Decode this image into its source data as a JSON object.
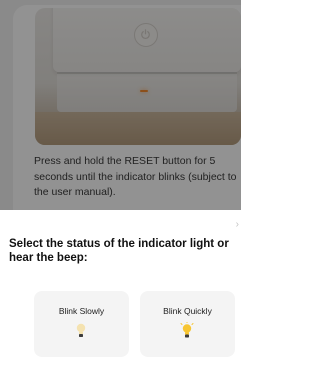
{
  "instruction": {
    "text": "Press and hold the RESET button for 5 seconds until the indicator blinks (subject to the user manual)."
  },
  "image": {
    "icon": "device-with-power-button",
    "led_color": "#f0892e"
  },
  "sheet": {
    "chevron": "›",
    "title": "Select the status of the indicator light or hear the beep:",
    "options": [
      {
        "label": "Blink Slowly",
        "icon": "bulb-dim-icon",
        "bulb_color": "#f4e2b0"
      },
      {
        "label": "Blink Quickly",
        "icon": "bulb-lit-icon",
        "bulb_color": "#f7c531"
      }
    ]
  },
  "colors": {
    "overlay": "rgba(0,0,0,0.42)",
    "card_bg": "#f4f4f4",
    "text_dark": "#111111"
  }
}
